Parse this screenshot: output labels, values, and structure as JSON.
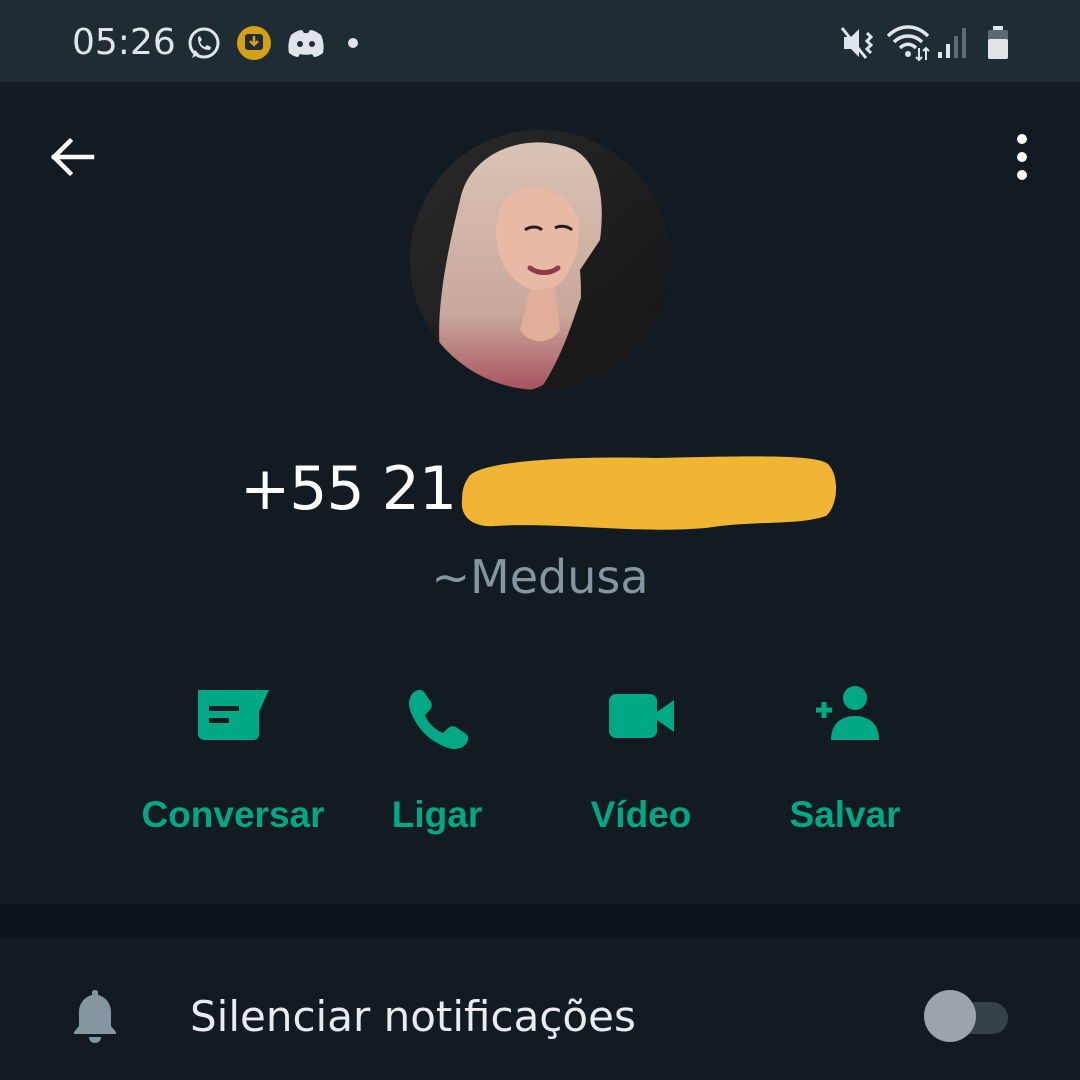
{
  "status_bar": {
    "time": "05:26",
    "left_icons": [
      "whatsapp-icon",
      "download-notification-icon",
      "discord-icon",
      "dot-icon"
    ],
    "right_icons": [
      "vibrate-mute-icon",
      "wifi-icon",
      "signal-icon",
      "battery-icon"
    ]
  },
  "header": {
    "back_icon": "arrow-left-icon",
    "menu_icon": "more-vertical-icon"
  },
  "contact": {
    "phone_visible": "+55 21",
    "phone_redacted": true,
    "pushname": "~Medusa"
  },
  "actions": [
    {
      "label": "Conversar",
      "icon": "message-icon"
    },
    {
      "label": "Ligar",
      "icon": "phone-icon"
    },
    {
      "label": "Vídeo",
      "icon": "video-icon"
    },
    {
      "label": "Salvar",
      "icon": "add-contact-icon"
    }
  ],
  "settings": {
    "mute_label": "Silenciar notificações",
    "mute_enabled": false
  },
  "colors": {
    "accent": "#00a884",
    "background": "#111b21",
    "status_bar": "#1f2c33",
    "redaction": "#f0b532"
  }
}
